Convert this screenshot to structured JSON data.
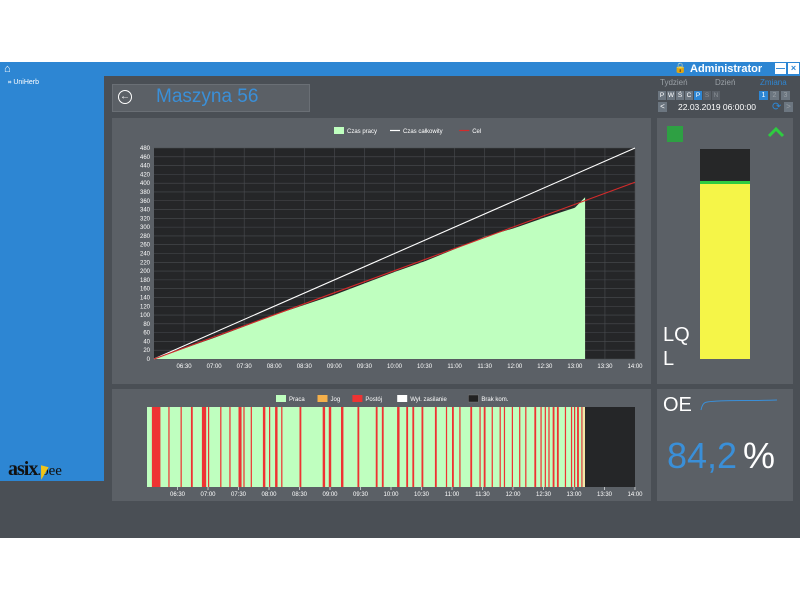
{
  "topbar": {
    "user": "Administrator",
    "lock_icon": "lock-icon",
    "home_icon": "home-icon",
    "minimize": "—",
    "close": "×"
  },
  "sidebar": {
    "items": [
      {
        "label": "UniHerb",
        "icon": "tree-item-icon"
      }
    ]
  },
  "logo": {
    "main": "asix",
    "sub": ".oee"
  },
  "header": {
    "title": "Maszyna 56",
    "back_icon": "back-circle-icon"
  },
  "period": {
    "week_label": "Tydzień",
    "day_label": "Dzień",
    "shift_label": "Zmiana",
    "days": [
      "P",
      "W",
      "Ś",
      "C",
      "P",
      "S",
      "N"
    ],
    "shifts": [
      "1",
      "2",
      "3"
    ],
    "active_shift": "1",
    "date": "22.03.2019 06:00:00",
    "prev": "<",
    "next": ">"
  },
  "status": {
    "line1": "LQ",
    "line2": "L",
    "level_fraction": 0.84
  },
  "oee": {
    "label": "OE",
    "value": "84,2",
    "unit": "%"
  },
  "colors": {
    "accent": "#2d86d3",
    "area": "#bfffbf",
    "target": "#d42b2b",
    "total": "#ffffff",
    "stop": "#ee3333",
    "level": "#f5f548"
  },
  "chart_data": [
    {
      "type": "area",
      "legend": [
        "Czas pracy",
        "Czas całkowity",
        "Cel"
      ],
      "x": [
        "06:30",
        "07:00",
        "07:30",
        "08:00",
        "08:30",
        "09:00",
        "09:30",
        "10:00",
        "10:30",
        "11:00",
        "11:30",
        "12:00",
        "12:30",
        "13:00",
        "13:30",
        "14:00"
      ],
      "xlim_hours": [
        6.0,
        14.0
      ],
      "ylim": [
        0,
        480
      ],
      "yticks": [
        0,
        20,
        40,
        60,
        80,
        100,
        120,
        140,
        160,
        180,
        200,
        220,
        240,
        260,
        280,
        300,
        320,
        340,
        360,
        380,
        400,
        420,
        440,
        460,
        480
      ],
      "series": [
        {
          "name": "Czas pracy",
          "type": "area",
          "points": [
            [
              6.0,
              0
            ],
            [
              7.0,
              48
            ],
            [
              8.0,
              100
            ],
            [
              9.0,
              146
            ],
            [
              10.0,
              198
            ],
            [
              10.5,
              222
            ],
            [
              11.0,
              250
            ],
            [
              11.5,
              278
            ],
            [
              12.0,
              298
            ],
            [
              12.5,
              322
            ],
            [
              13.0,
              344
            ],
            [
              13.17,
              368
            ],
            [
              13.17,
              0
            ]
          ]
        },
        {
          "name": "Czas całkowity",
          "type": "line",
          "points": [
            [
              6.0,
              0
            ],
            [
              14.0,
              480
            ]
          ]
        },
        {
          "name": "Cel",
          "type": "line",
          "points": [
            [
              6.0,
              0
            ],
            [
              14.0,
              402
            ]
          ]
        }
      ]
    },
    {
      "type": "timeline",
      "legend": [
        "Praca",
        "Jog",
        "Postój",
        "Wył. zasilanie",
        "Brak kom."
      ],
      "x": [
        "06:30",
        "07:00",
        "07:30",
        "08:00",
        "08:30",
        "09:00",
        "09:30",
        "10:00",
        "10:30",
        "11:00",
        "11:30",
        "12:00",
        "12:30",
        "13:00",
        "13:30",
        "14:00"
      ],
      "xlim_hours": [
        6.0,
        14.0
      ],
      "base_state": "Praca",
      "stops_hours": [
        [
          6.08,
          6.22
        ],
        [
          6.35,
          6.37
        ],
        [
          6.55,
          6.57
        ],
        [
          6.72,
          6.75
        ],
        [
          6.9,
          6.97
        ],
        [
          7.0,
          7.02
        ],
        [
          7.2,
          7.22
        ],
        [
          7.35,
          7.37
        ],
        [
          7.5,
          7.55
        ],
        [
          7.58,
          7.6
        ],
        [
          7.7,
          7.72
        ],
        [
          7.9,
          7.94
        ],
        [
          8.0,
          8.02
        ],
        [
          8.1,
          8.14
        ],
        [
          8.2,
          8.22
        ],
        [
          8.5,
          8.53
        ],
        [
          8.88,
          8.92
        ],
        [
          8.98,
          9.02
        ],
        [
          9.18,
          9.22
        ],
        [
          9.45,
          9.48
        ],
        [
          9.75,
          9.78
        ],
        [
          9.85,
          9.88
        ],
        [
          10.1,
          10.14
        ],
        [
          10.25,
          10.28
        ],
        [
          10.35,
          10.38
        ],
        [
          10.5,
          10.53
        ],
        [
          10.72,
          10.75
        ],
        [
          10.9,
          10.92
        ],
        [
          11.0,
          11.03
        ],
        [
          11.12,
          11.14
        ],
        [
          11.3,
          11.33
        ],
        [
          11.45,
          11.47
        ],
        [
          11.52,
          11.55
        ],
        [
          11.65,
          11.67
        ],
        [
          11.78,
          11.8
        ],
        [
          11.85,
          11.87
        ],
        [
          11.98,
          12.0
        ],
        [
          12.1,
          12.12
        ],
        [
          12.2,
          12.22
        ],
        [
          12.35,
          12.38
        ],
        [
          12.45,
          12.47
        ],
        [
          12.52,
          12.54
        ],
        [
          12.58,
          12.6
        ],
        [
          12.65,
          12.68
        ],
        [
          12.72,
          12.75
        ],
        [
          12.85,
          12.87
        ],
        [
          12.95,
          12.97
        ],
        [
          13.0,
          13.02
        ],
        [
          13.05,
          13.08
        ],
        [
          13.12,
          13.14
        ]
      ],
      "jog_hours": [
        [
          13.15,
          13.18
        ]
      ],
      "nocomm_from_hours": 13.18
    }
  ]
}
